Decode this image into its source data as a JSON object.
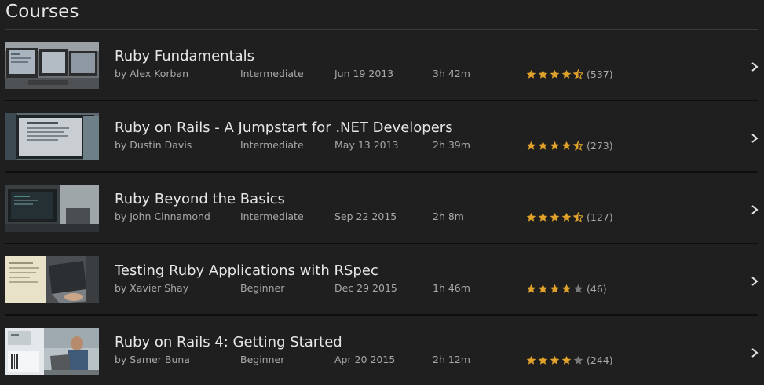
{
  "page": {
    "title": "Courses"
  },
  "colors": {
    "background": "#1f1f1f",
    "star_filled": "#e0a22b",
    "star_empty": "#7a7a7a",
    "text": "#e6e6e6",
    "muted": "#a8a8a8"
  },
  "courses": [
    {
      "title": "Ruby Fundamentals",
      "author": "by Alex Korban",
      "level": "Intermediate",
      "date": "Jun 19 2013",
      "duration": "3h 42m",
      "rating": 4.5,
      "rating_count": "(537)",
      "thumb_icon": "monitors-office-thumbnail"
    },
    {
      "title": "Ruby on Rails - A Jumpstart for .NET Developers",
      "author": "by Dustin Davis",
      "level": "Intermediate",
      "date": "May 13 2013",
      "duration": "2h 39m",
      "rating": 4.5,
      "rating_count": "(273)",
      "thumb_icon": "monitor-slide-thumbnail"
    },
    {
      "title": "Ruby Beyond the Basics",
      "author": "by John Cinnamond",
      "level": "Intermediate",
      "date": "Sep 22 2015",
      "duration": "2h 8m",
      "rating": 4.5,
      "rating_count": "(127)",
      "thumb_icon": "dark-desk-monitor-thumbnail"
    },
    {
      "title": "Testing Ruby Applications with RSpec",
      "author": "by Xavier Shay",
      "level": "Beginner",
      "date": "Dec 29 2015",
      "duration": "1h 46m",
      "rating": 4,
      "rating_count": "(46)",
      "thumb_icon": "laptop-typing-thumbnail"
    },
    {
      "title": "Ruby on Rails 4: Getting Started",
      "author": "by Samer Buna",
      "level": "Beginner",
      "date": "Apr 20 2015",
      "duration": "2h 12m",
      "rating": 4,
      "rating_count": "(244)",
      "thumb_icon": "train-laptop-thumbnail"
    }
  ],
  "icons": {
    "row_action": "chevron-right-icon",
    "rating_star": "star-icon"
  }
}
